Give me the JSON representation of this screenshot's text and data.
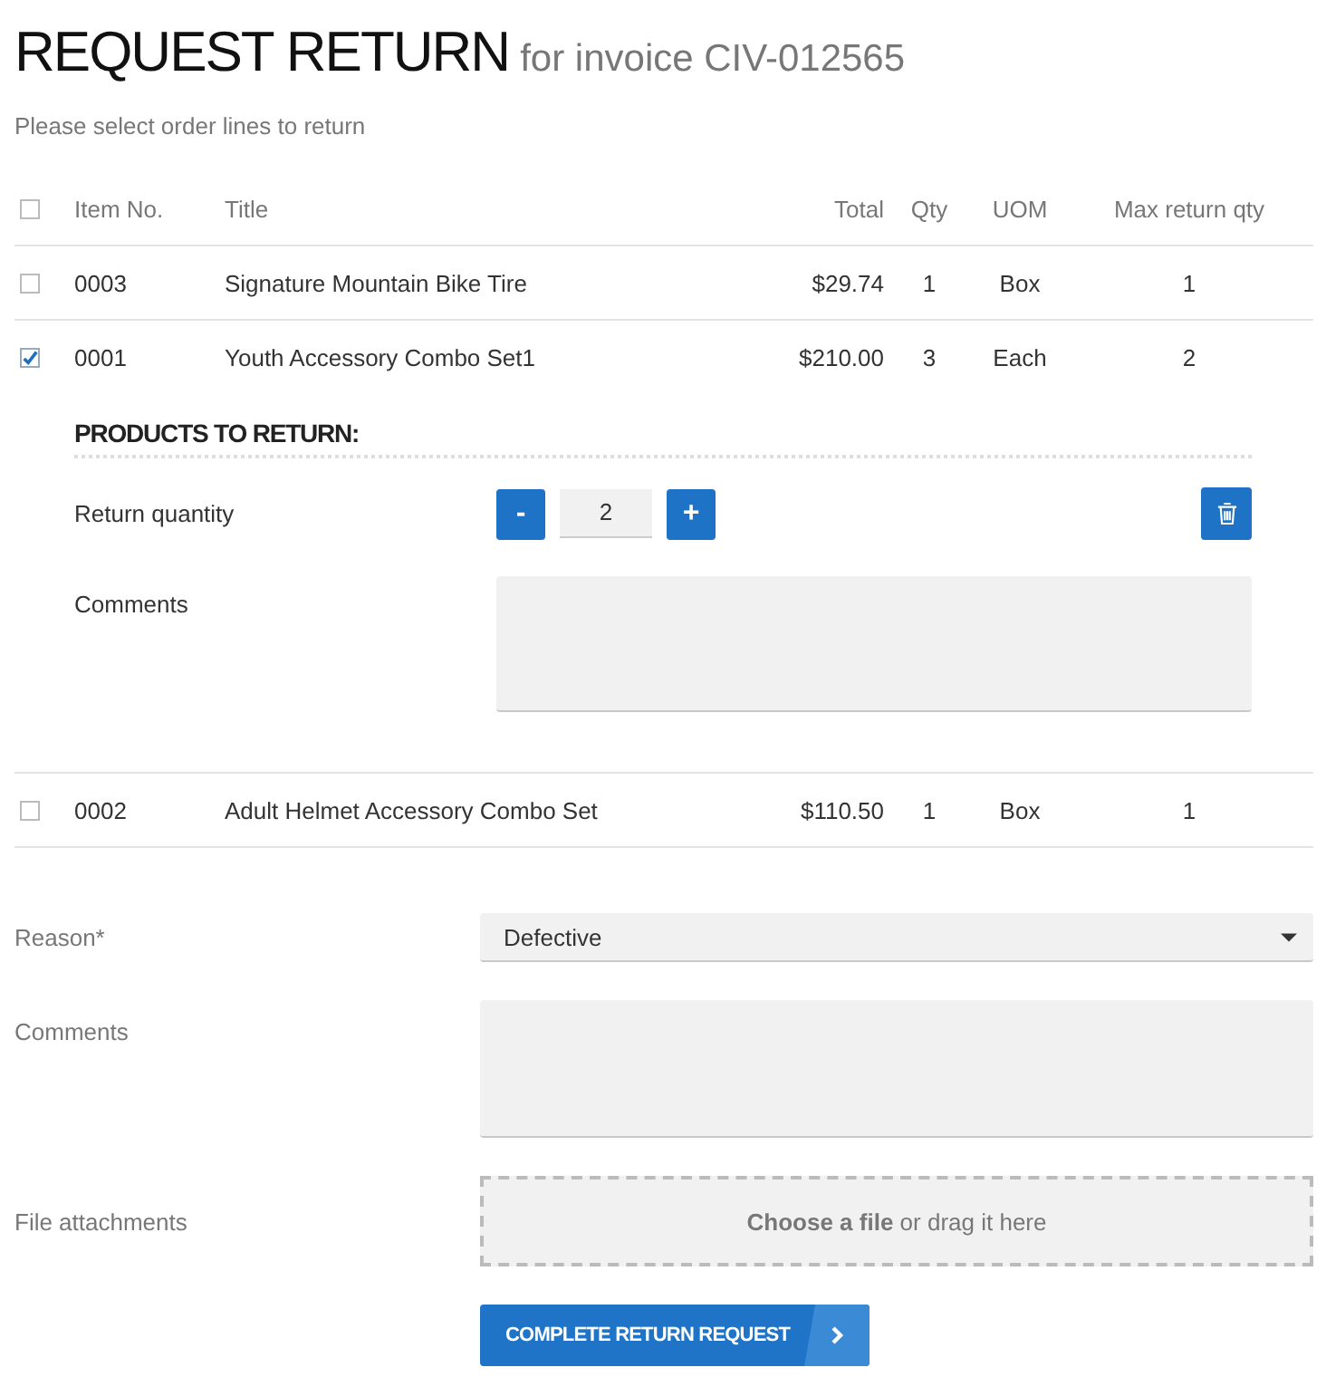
{
  "header": {
    "title": "REQUEST RETURN",
    "subtitle": "for invoice CIV-012565",
    "instruction": "Please select order lines to return"
  },
  "table": {
    "select_all": {
      "checked": false
    },
    "columns": [
      "Item No.",
      "Title",
      "Total",
      "Qty",
      "UOM",
      "Max return qty"
    ],
    "rows": [
      {
        "checked": false,
        "cells": [
          "0003",
          "Signature Mountain Bike Tire",
          "$29.74",
          "1",
          "Box",
          "1"
        ]
      },
      {
        "checked": true,
        "cells": [
          "0001",
          "Youth Accessory Combo Set1",
          "$210.00",
          "3",
          "Each",
          "2"
        ],
        "return_panel": {
          "heading": "PRODUCTS TO RETURN:",
          "quantity_label": "Return quantity",
          "decrement": "-",
          "quantity": "2",
          "increment": "+",
          "comments_label": "Comments"
        }
      },
      {
        "checked": false,
        "cells": [
          "0002",
          "Adult Helmet Accessory Combo Set",
          "$110.50",
          "1",
          "Box",
          "1"
        ]
      }
    ]
  },
  "form": {
    "reason": {
      "label": "Reason*",
      "value": "Defective"
    },
    "comments": {
      "label": "Comments"
    },
    "attachments": {
      "label": "File attachments",
      "dropzone": "**Choose a file** or drag it here"
    },
    "submit": {
      "label": "COMPLETE RETURN REQUEST"
    }
  }
}
